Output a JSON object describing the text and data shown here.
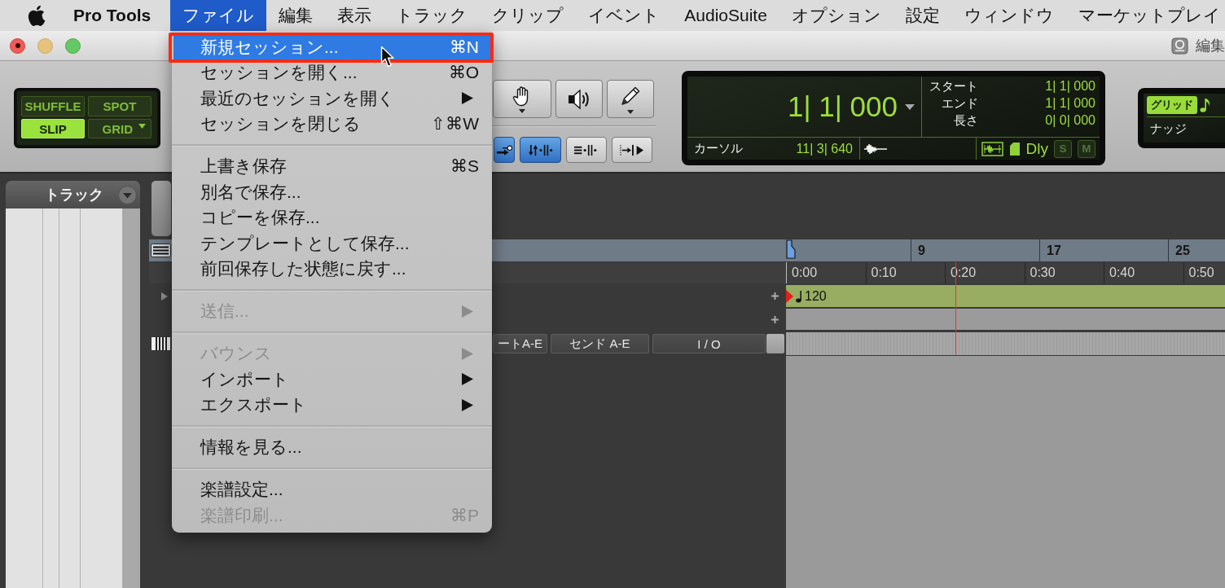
{
  "menubar": {
    "app_name": "Pro Tools",
    "menus": [
      {
        "label": "ファイル",
        "selected": true
      },
      {
        "label": "編集",
        "selected": false
      },
      {
        "label": "表示",
        "selected": false
      },
      {
        "label": "トラック",
        "selected": false
      },
      {
        "label": "クリップ",
        "selected": false
      },
      {
        "label": "イベント",
        "selected": false
      },
      {
        "label": "AudioSuite",
        "selected": false
      },
      {
        "label": "オプション",
        "selected": false
      },
      {
        "label": "設定",
        "selected": false
      },
      {
        "label": "ウィンドウ",
        "selected": false
      },
      {
        "label": "マーケットプレイ",
        "selected": false
      }
    ]
  },
  "window": {
    "title": "編集"
  },
  "edit_modes": [
    {
      "label": "SHUFFLE",
      "kind": "plain",
      "selected": false
    },
    {
      "label": "SPOT",
      "kind": "plain",
      "selected": false
    },
    {
      "label": "SLIP",
      "kind": "plain",
      "selected": true
    },
    {
      "label": "GRID",
      "kind": "menu",
      "selected": false
    }
  ],
  "edit_toggles": [
    {
      "kind": "link",
      "selected": true
    },
    {
      "kind": "insertion",
      "selected": true
    },
    {
      "kind": "lines",
      "selected": false
    },
    {
      "kind": "follow",
      "selected": false
    }
  ],
  "counter": {
    "main": "1| 1| 000",
    "selection": [
      {
        "label": "スタート",
        "value": "1| 1| 000"
      },
      {
        "label": "エンド",
        "value": "1| 1| 000"
      },
      {
        "label": "長さ",
        "value": "0| 0| 000"
      }
    ],
    "cursor_label": "カーソル",
    "cursor": "11| 3| 640",
    "delay": "Dly",
    "solo": {
      "label": "S",
      "on": false
    },
    "mute": {
      "label": "M",
      "on": false
    }
  },
  "grid_nudge": {
    "grid": "グリッド",
    "nudge": "ナッジ"
  },
  "tracks_panel": {
    "title": "トラック"
  },
  "rulers": {
    "bars": [
      "9",
      "17",
      "25"
    ],
    "minutes": [
      "0:00",
      "0:10",
      "0:20",
      "0:30",
      "0:40",
      "0:50"
    ],
    "tempo": "120"
  },
  "column_headers": [
    "ートA-E",
    "センド A-E",
    "I / O"
  ],
  "file_menu": {
    "groups": [
      {
        "items": [
          {
            "label": "新規セッション...",
            "shortcut": "⌘N",
            "submenu": false,
            "disabled": false,
            "selected": true,
            "outlined": true
          },
          {
            "label": "セッションを開く...",
            "shortcut": "⌘O",
            "submenu": false,
            "disabled": false,
            "selected": false,
            "outlined": false
          },
          {
            "label": "最近のセッションを開く",
            "submenu": true,
            "disabled": false,
            "selected": false,
            "outlined": false
          },
          {
            "label": "セッションを閉じる",
            "shortcut": "⇧⌘W",
            "submenu": false,
            "disabled": false,
            "selected": false,
            "outlined": false
          }
        ]
      },
      {
        "items": [
          {
            "label": "上書き保存",
            "shortcut": "⌘S",
            "submenu": false,
            "disabled": false,
            "selected": false,
            "outlined": false
          },
          {
            "label": "別名で保存...",
            "submenu": false,
            "disabled": false,
            "selected": false,
            "outlined": false
          },
          {
            "label": "コピーを保存...",
            "submenu": false,
            "disabled": false,
            "selected": false,
            "outlined": false
          },
          {
            "label": "テンプレートとして保存...",
            "submenu": false,
            "disabled": false,
            "selected": false,
            "outlined": false
          },
          {
            "label": "前回保存した状態に戻す...",
            "submenu": false,
            "disabled": false,
            "selected": false,
            "outlined": false
          }
        ]
      },
      {
        "items": [
          {
            "label": "送信...",
            "submenu": true,
            "disabled": true,
            "selected": false,
            "outlined": false
          }
        ]
      },
      {
        "items": [
          {
            "label": "バウンス",
            "submenu": true,
            "disabled": true,
            "selected": false,
            "outlined": false
          },
          {
            "label": "インポート",
            "submenu": true,
            "disabled": false,
            "selected": false,
            "outlined": false
          },
          {
            "label": "エクスポート",
            "submenu": true,
            "disabled": false,
            "selected": false,
            "outlined": false
          }
        ]
      },
      {
        "items": [
          {
            "label": "情報を見る...",
            "submenu": false,
            "disabled": false,
            "selected": false,
            "outlined": false
          }
        ]
      },
      {
        "items": [
          {
            "label": "楽譜設定...",
            "submenu": false,
            "disabled": false,
            "selected": false,
            "outlined": false
          },
          {
            "label": "楽譜印刷...",
            "shortcut": "⌘P",
            "submenu": false,
            "disabled": true,
            "selected": false,
            "outlined": false
          }
        ]
      }
    ]
  }
}
